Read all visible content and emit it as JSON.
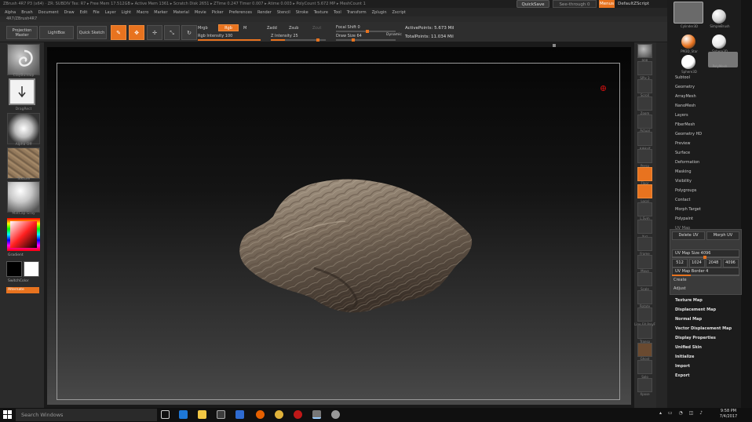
{
  "titlebar": {
    "text": "ZBrush 4R7 P3 (x64) · ZR: SUBDIV  Tex: R7  ▸ Free Mem 17.512GB ▸ Active Mem 1361 ▸ Scratch Disk 2651 ▸ ZTime 0.247 Timer 0.007 ▸ Atime 0.003 ▸ PolyCount 5.672 MP ▸ MeshCount 1"
  },
  "menubar": [
    "Alpha",
    "Brush",
    "Document",
    "Draw",
    "Edit",
    "File",
    "Layer",
    "Light",
    "Macro",
    "Marker",
    "Material",
    "Movie",
    "Picker",
    "Preferences",
    "Render",
    "Stencil",
    "Stroke",
    "Texture",
    "Tool",
    "Transform",
    "Zplugin",
    "Zscript"
  ],
  "top_right": {
    "quicksave": "QuickSave",
    "seethrough": "See-through  0",
    "menus": "Menus",
    "defaultzscript": "DefaultZScript"
  },
  "subtitle": "4R7/ZBrush4R7",
  "toolbar": {
    "projection_master": "Projection Master",
    "lightbox": "LightBox",
    "quick_sketch": "Quick Sketch",
    "edit": "Edit",
    "draw": "Draw",
    "move": "Move",
    "scale": "Scale",
    "rotate": "Rotate",
    "mrgb": "Mrgb",
    "rgb": "Rgb",
    "m": "M",
    "rgb_intensity": "Rgb Intensity 100",
    "zadd": "Zadd",
    "zsub": "Zsub",
    "zcut": "Zcut",
    "z_intensity": "Z Intensity 25",
    "focal_shift": "Focal Shift 0",
    "draw_size": "Draw Size 64",
    "dynamic": "Dynamic",
    "active_points": "ActivePoints: 5.673 Mil",
    "total_points": "TotalPoints: 11.034 Mil"
  },
  "left_shelf": {
    "brush_label": "ClayBuildup",
    "stroke_label": "DragRect",
    "alpha_label": "Alpha Off",
    "texture_label": "Texture",
    "material_label": "MatCap Gray",
    "gradient": "Gradient",
    "switch_color": "SwitchColor",
    "alternate": "Alternate"
  },
  "right_shelf": [
    "BPR",
    "SPix 3",
    "Scroll",
    "Zoom",
    "Actual",
    "AAHalf",
    "Persp",
    "Floor",
    "Local",
    "L.Sym",
    "Xyz",
    "Frame",
    "Move",
    "Scale",
    "Rotate",
    "Line Fill PolyF",
    "Transp",
    "Ghost",
    "Solo",
    "Xpose"
  ],
  "tray": {
    "tools": [
      "Cylinder3D",
      "SimpleBrush",
      "PM3D_Star",
      "Sphere3D",
      "Sphere3D",
      "PolyMesh"
    ],
    "subpalettes": [
      "Subtool",
      "Geometry",
      "ArrayMesh",
      "NanoMesh",
      "Layers",
      "FiberMesh",
      "Geometry HD",
      "Preview",
      "Surface",
      "Deformation",
      "Masking",
      "Visibility",
      "Polygroups",
      "Contact",
      "Morph Target",
      "Polypaint",
      "UV Map"
    ],
    "uv": {
      "delete_uv": "Delete UV",
      "morph_uv": "Morph UV",
      "uv_map_size": "UV Map Size 4096",
      "sizes": [
        "512",
        "1024",
        "2048",
        "4096"
      ],
      "uv_map_border": "UV Map Border 4",
      "create": "Create",
      "adjust": "Adjust"
    },
    "bottom_items": [
      "Texture Map",
      "Displacement Map",
      "Normal Map",
      "Vector Displacement Map",
      "Display Properties",
      "Unified Skin",
      "Initialize",
      "Import",
      "Export"
    ]
  },
  "taskbar": {
    "search": "Search Windows",
    "time": "9:58 PM",
    "date": "7/4/2017"
  },
  "colors": {
    "accent": "#e8731f"
  }
}
